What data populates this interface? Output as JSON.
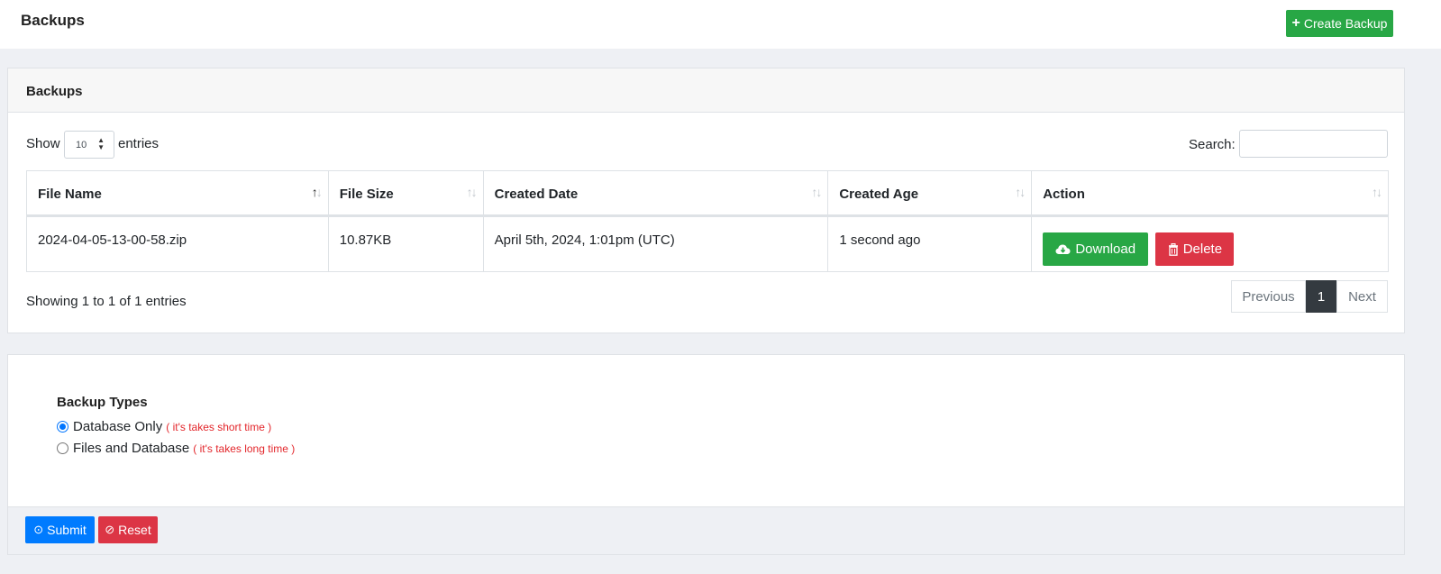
{
  "header": {
    "title": "Backups",
    "create_button": {
      "label": "Create Backup",
      "icon": "plus-icon"
    }
  },
  "backups_card": {
    "title": "Backups",
    "length": {
      "show_label": "Show",
      "value": "10",
      "entries_label": "entries"
    },
    "search": {
      "label": "Search:",
      "value": "",
      "placeholder": ""
    },
    "table": {
      "columns": [
        {
          "label": "File Name",
          "sort": "ascending"
        },
        {
          "label": "File Size",
          "sort": "none"
        },
        {
          "label": "Created Date",
          "sort": "none"
        },
        {
          "label": "Created Age",
          "sort": "none"
        },
        {
          "label": "Action",
          "sort": "none"
        }
      ],
      "rows": [
        {
          "file_name": "2024-04-05-13-00-58.zip",
          "file_size": "10.87KB",
          "created_date": "April 5th, 2024, 1:01pm (UTC)",
          "created_age": "1 second ago",
          "download_label": "Download",
          "delete_label": "Delete"
        }
      ]
    },
    "info": "Showing 1 to 1 of 1 entries",
    "pagination": {
      "previous": "Previous",
      "current": "1",
      "next": "Next"
    }
  },
  "backup_types": {
    "title": "Backup Types",
    "options": [
      {
        "label": "Database Only",
        "hint": "( it's takes short time )",
        "checked": true
      },
      {
        "label": "Files and Database",
        "hint": "( it's takes long time )",
        "checked": false
      }
    ],
    "submit_label": "Submit",
    "reset_label": "Reset"
  },
  "colors": {
    "success": "#28a745",
    "danger": "#dc3545",
    "primary": "#007bff",
    "hint": "#e3262b"
  }
}
